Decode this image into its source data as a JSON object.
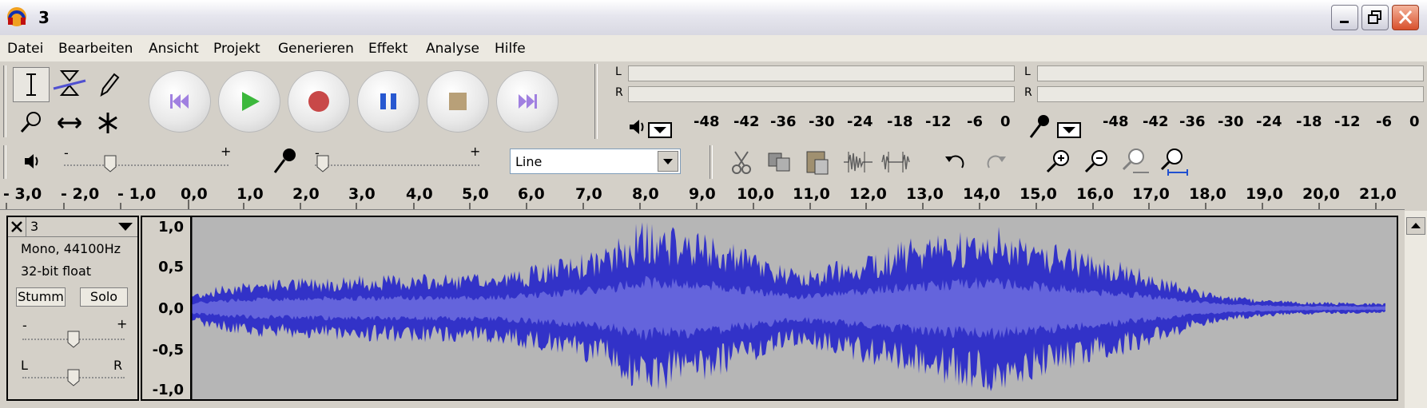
{
  "window": {
    "title": "3"
  },
  "menu": [
    "Datei",
    "Bearbeiten",
    "Ansicht",
    "Projekt",
    "Generieren",
    "Effekt",
    "Analyse",
    "Hilfe"
  ],
  "meters": {
    "play_labels": {
      "left": "L",
      "right": "R"
    },
    "rec_labels": {
      "left": "L",
      "right": "R"
    },
    "scale": [
      "-48",
      "-42",
      "-36",
      "-30",
      "-24",
      "-18",
      "-12",
      "-6",
      "0"
    ]
  },
  "mixer": {
    "vol_minus": "-",
    "vol_plus": "+",
    "mic_minus": "-",
    "mic_plus": "+",
    "input_source": "Line"
  },
  "ruler": [
    "- 3,0",
    "- 2,0",
    "- 1,0",
    "0,0",
    "1,0",
    "2,0",
    "3,0",
    "4,0",
    "5,0",
    "6,0",
    "7,0",
    "8,0",
    "9,0",
    "10,0",
    "11,0",
    "12,0",
    "13,0",
    "14,0",
    "15,0",
    "16,0",
    "17,0",
    "18,0",
    "19,0",
    "20,0",
    "21,0"
  ],
  "track": {
    "name": "3",
    "format": "Mono, 44100Hz",
    "bitdepth": "32-bit float",
    "mute": "Stumm",
    "solo": "Solo",
    "gain_minus": "-",
    "gain_plus": "+",
    "pan_left": "L",
    "pan_right": "R",
    "yaxis": [
      "1,0",
      "0,5",
      "0,0",
      "-0,5",
      "-1,0"
    ]
  },
  "colors": {
    "wave_dark": "#3232c8",
    "wave_light": "#6464dc",
    "wave_bg": "#b6b6b6"
  }
}
